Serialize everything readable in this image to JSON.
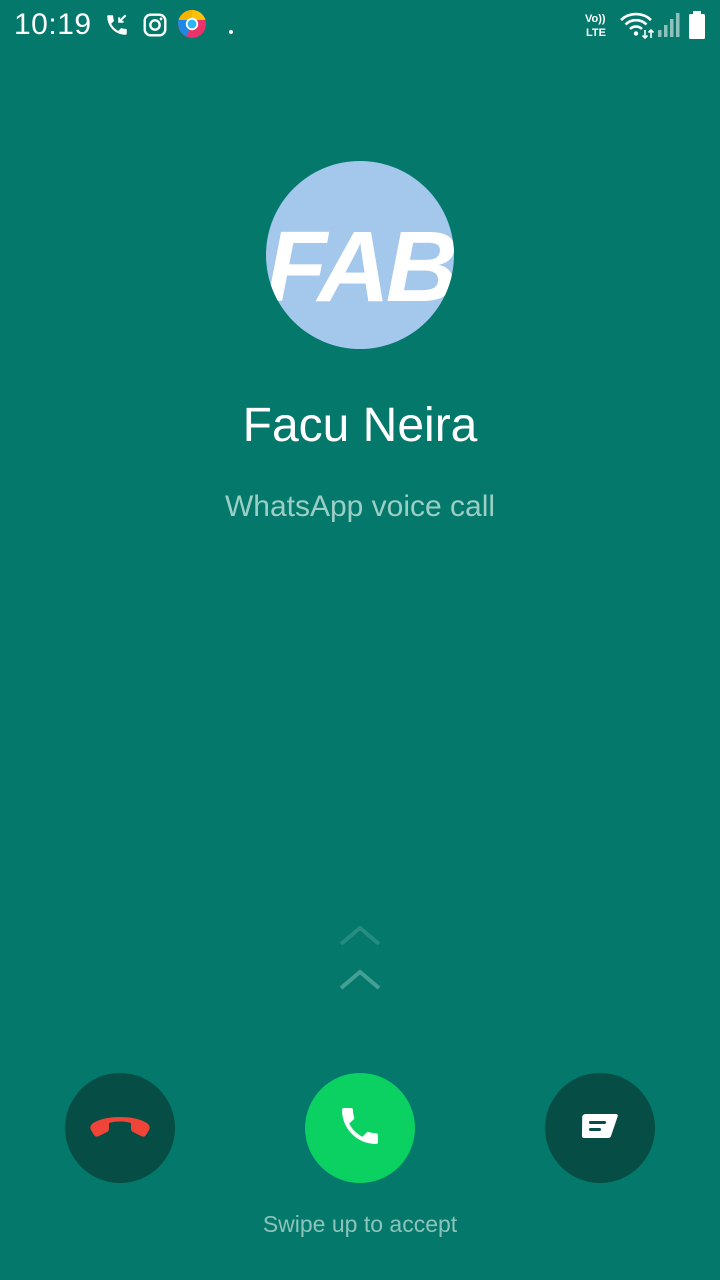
{
  "status_bar": {
    "time": "10:19",
    "left_icons": [
      "missed-call-icon",
      "instagram-icon",
      "chrome-icon",
      "dot-icon"
    ],
    "right_icons": [
      "volte-icon",
      "wifi-icon",
      "signal-icon",
      "battery-icon"
    ],
    "volte_label_top": "Vo))",
    "volte_label_bottom": "LTE"
  },
  "caller": {
    "avatar_text": "FAB",
    "name": "Facu Neira",
    "call_type": "WhatsApp voice call"
  },
  "actions": {
    "decline_icon": "decline-phone-icon",
    "accept_icon": "phone-icon",
    "message_icon": "message-icon",
    "swipe_hint": "Swipe up to accept"
  },
  "colors": {
    "background": "#03786B",
    "accept": "#0BD162",
    "decline_icon": "#F04438",
    "secondary_button": "#064D45",
    "avatar_bg": "#A4C8EC"
  }
}
